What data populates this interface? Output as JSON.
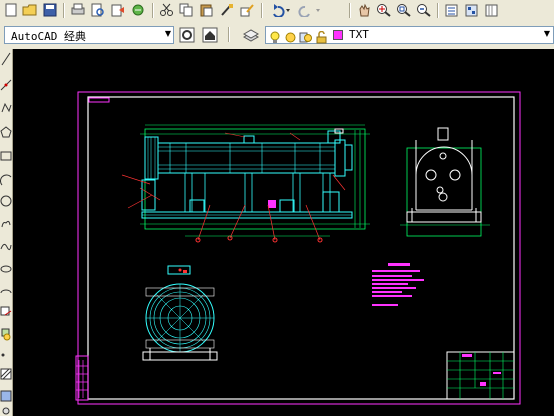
{
  "toolbar": {
    "buttons": [
      {
        "name": "new-icon"
      },
      {
        "name": "open-icon"
      },
      {
        "name": "save-icon"
      },
      {
        "name": "print-icon"
      },
      {
        "name": "plot-preview-icon"
      },
      {
        "name": "publish-icon"
      },
      {
        "name": "3d-dwf-icon"
      },
      {
        "name": "cut-icon"
      },
      {
        "name": "copy-icon"
      },
      {
        "name": "paste-icon"
      },
      {
        "name": "match-properties-icon"
      },
      {
        "name": "block-editor-icon"
      },
      {
        "name": "undo-icon"
      },
      {
        "name": "redo-icon"
      },
      {
        "name": "pan-icon"
      },
      {
        "name": "zoom-realtime-icon"
      },
      {
        "name": "zoom-window-icon"
      },
      {
        "name": "zoom-previous-icon"
      },
      {
        "name": "properties-icon"
      },
      {
        "name": "design-center-icon"
      },
      {
        "name": "tool-palettes-icon"
      }
    ]
  },
  "workspace": {
    "selected": "AutoCAD 经典"
  },
  "layer": {
    "current": "TXT"
  },
  "colors": {
    "toolbar_bg": "#ece9d8",
    "canvas_bg": "#000000",
    "frame": "#ff33ff",
    "geometry": "#00ff66",
    "cyan": "#33ffff",
    "red": "#ff3333",
    "yellow": "#ffff33"
  }
}
